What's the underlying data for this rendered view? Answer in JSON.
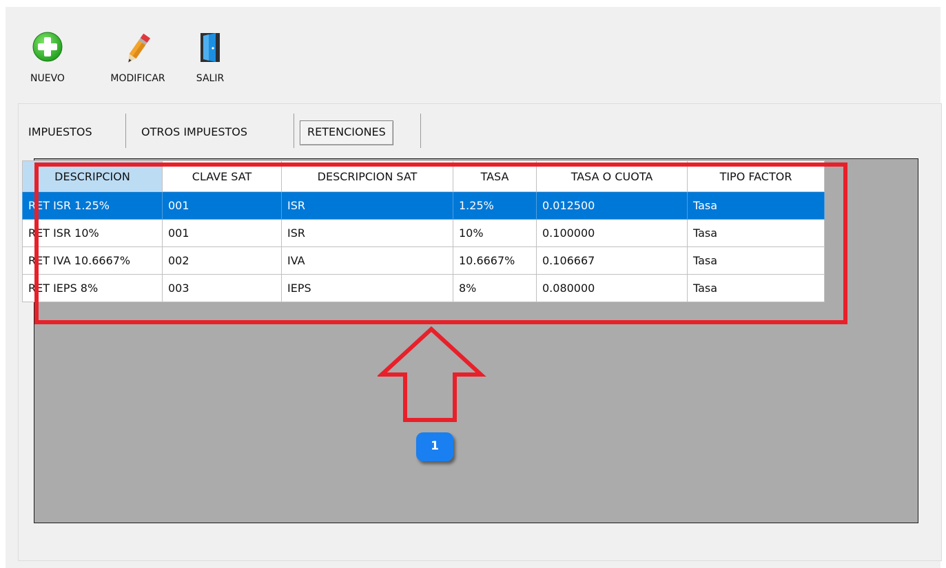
{
  "toolbar": {
    "buttons": [
      {
        "label": "NUEVO",
        "icon": "plus-circle-icon"
      },
      {
        "label": "MODIFICAR",
        "icon": "pencil-icon"
      },
      {
        "label": "SALIR",
        "icon": "door-exit-icon"
      }
    ]
  },
  "tabs": [
    {
      "label": "IMPUESTOS"
    },
    {
      "label": "OTROS IMPUESTOS"
    },
    {
      "label": "RETENCIONES",
      "active": true
    }
  ],
  "table": {
    "columns": [
      "DESCRIPCION",
      "CLAVE SAT",
      "DESCRIPCION SAT",
      "TASA",
      "TASA O CUOTA",
      "TIPO FACTOR"
    ],
    "sorted_column": "DESCRIPCION",
    "rows": [
      [
        "RET ISR 1.25%",
        "001",
        "ISR",
        "1.25%",
        "0.012500",
        "Tasa"
      ],
      [
        "RET ISR 10%",
        "001",
        "ISR",
        "10%",
        "0.100000",
        "Tasa"
      ],
      [
        "RET IVA 10.6667%",
        "002",
        "IVA",
        "10.6667%",
        "0.106667",
        "Tasa"
      ],
      [
        "RET IEPS 8%",
        "003",
        "IEPS",
        "8%",
        "0.080000",
        "Tasa"
      ]
    ],
    "selected_row": 0
  },
  "annotation": {
    "callout_number": "1",
    "highlight_color": "#e8202a",
    "badge_color": "#1a7ff0"
  },
  "colors": {
    "selection": "#0078d7",
    "header_sorted": "#bcdcf4",
    "grid_background": "#ababab"
  }
}
